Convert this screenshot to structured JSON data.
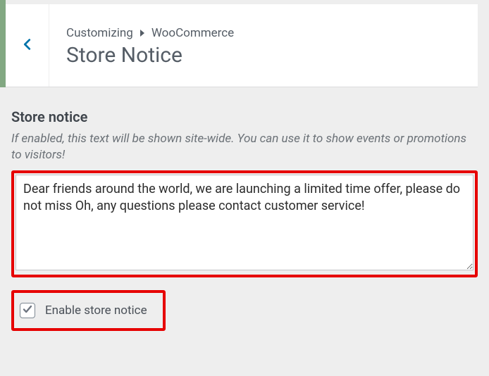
{
  "header": {
    "breadcrumb_root": "Customizing",
    "breadcrumb_parent": "WooCommerce",
    "title": "Store Notice"
  },
  "section": {
    "title": "Store notice",
    "description": "If enabled, this text will be shown site-wide. You can use it to show events or promotions to visitors!"
  },
  "notice_text": "Dear friends around the world, we are launching a limited time offer, please do not miss Oh, any questions please contact customer service!",
  "enable_checkbox": {
    "label": "Enable store notice",
    "checked": true
  },
  "colors": {
    "highlight": "#e60000",
    "back_arrow": "#0073aa"
  }
}
